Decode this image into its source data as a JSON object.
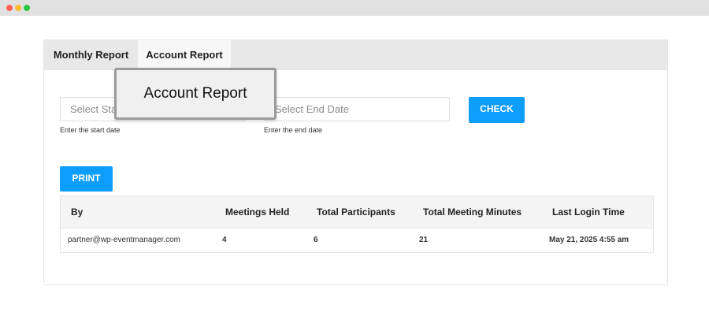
{
  "window": {
    "controls": [
      "close-dot",
      "minimize-dot",
      "maximize-dot"
    ]
  },
  "tabs": [
    {
      "label": "Monthly Report",
      "active": false
    },
    {
      "label": "Account Report",
      "active": true
    }
  ],
  "filters": {
    "start_placeholder": "Select Start Date",
    "start_hint": "Enter the start date",
    "end_placeholder": "Select End Date",
    "end_hint": "Enter the end date",
    "check_label": "CHECK"
  },
  "print_label": "PRINT",
  "table": {
    "headers": [
      "By",
      "Meetings Held",
      "Total Participants",
      "Total Meeting Minutes",
      "Last Login Time"
    ],
    "rows": [
      [
        "partner@wp-eventmanager.com",
        "4",
        "6",
        "21",
        "May 21, 2025 4:55 am"
      ]
    ]
  },
  "tooltip": {
    "text": "Account Report"
  },
  "colors": {
    "accent": "#0d9dfb",
    "tab_bar": "#e8e8e8",
    "table_header": "#f4f4f4"
  }
}
